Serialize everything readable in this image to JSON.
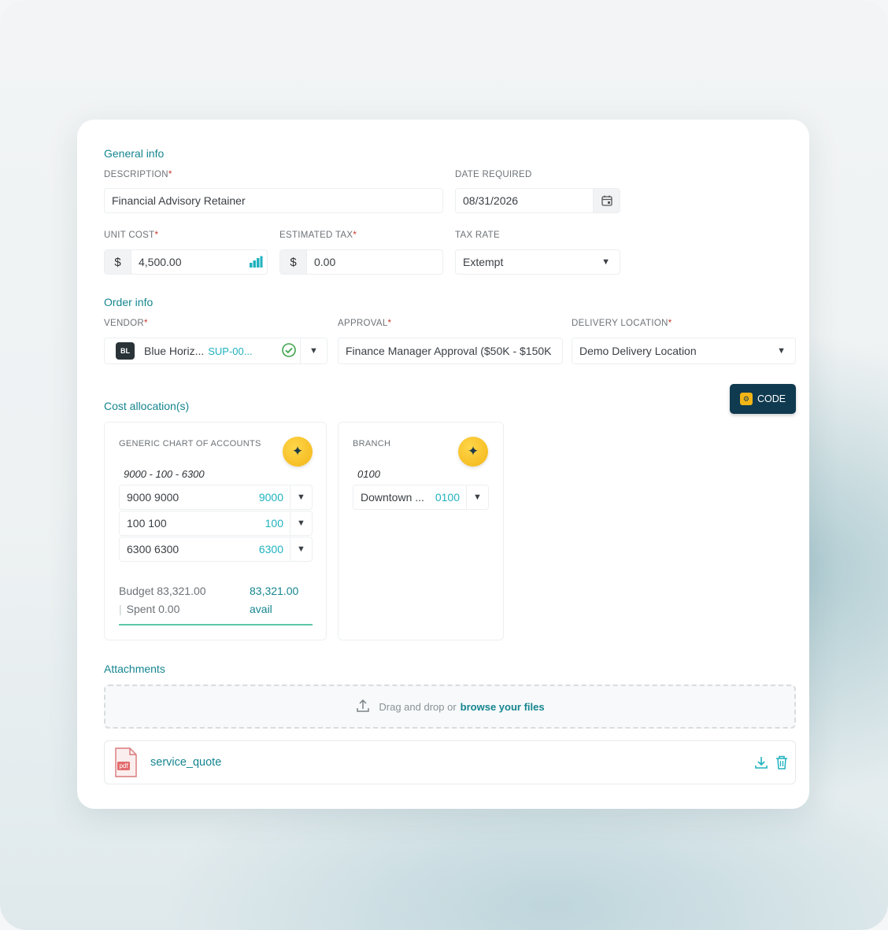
{
  "general_info": {
    "title": "General info",
    "description_label": "DESCRIPTION",
    "description_value": "Financial Advisory Retainer",
    "date_label": "DATE REQUIRED",
    "date_value": "08/31/2026",
    "unit_cost_label": "UNIT COST",
    "unit_cost_currency": "$",
    "unit_cost_value": "4,500.00",
    "est_tax_label": "ESTIMATED TAX",
    "est_tax_currency": "$",
    "est_tax_value": "0.00",
    "tax_rate_label": "TAX RATE",
    "tax_rate_value": "Extempt",
    "required_mark": "*"
  },
  "order_info": {
    "title": "Order info",
    "vendor_label": "VENDOR",
    "vendor_badge": "BL",
    "vendor_name": "Blue Horiz...",
    "vendor_code": "SUP-00...",
    "approval_label": "APPROVAL",
    "approval_value": "Finance Manager Approval ($50K - $150K",
    "delivery_label": "DELIVERY LOCATION",
    "delivery_value": "Demo Delivery Location"
  },
  "cost_allocation": {
    "title": "Cost allocation(s)",
    "code_button": "CODE",
    "generic": {
      "label": "GENERIC CHART OF ACCOUNTS",
      "path": "9000 - 100 - 6300",
      "segments": [
        {
          "name": "9000 9000",
          "code": "9000"
        },
        {
          "name": "100 100",
          "code": "100"
        },
        {
          "name": "6300 6300",
          "code": "6300"
        }
      ],
      "budget_text": "Budget 83,321.00",
      "spent_text": "Spent 0.00",
      "avail_amount": "83,321.00",
      "avail_label": "avail"
    },
    "branch": {
      "label": "BRANCH",
      "path": "0100",
      "name": "Downtown ...",
      "code": "0100"
    }
  },
  "attachments": {
    "title": "Attachments",
    "drop_text": "Drag and drop or",
    "browse_text": "browse your files",
    "file_name": "service_quote",
    "file_ext": "pdf"
  },
  "colors": {
    "accent": "#15858f",
    "link": "#20b2bf",
    "code_button": "#0f3a4f",
    "star": "#f2b516"
  }
}
